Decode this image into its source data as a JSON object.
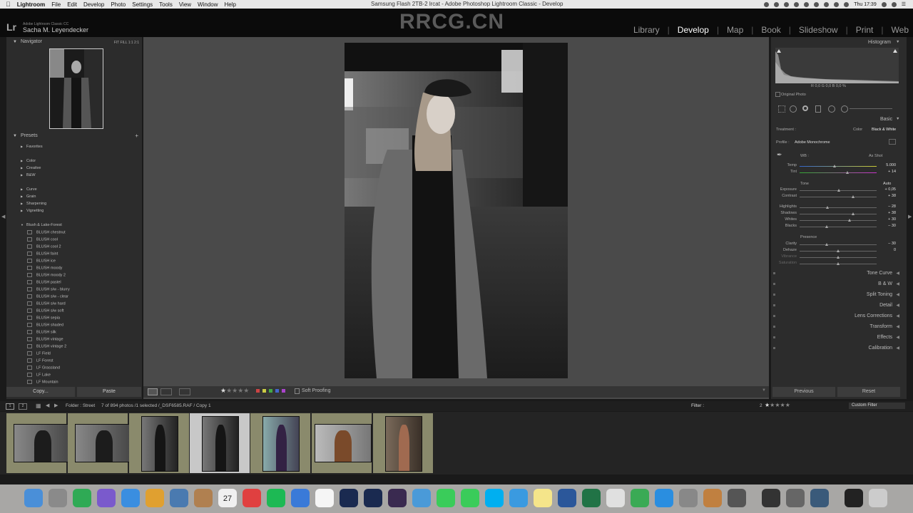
{
  "menubar": {
    "apple": "",
    "items": [
      "Lightroom",
      "File",
      "Edit",
      "Develop",
      "Photo",
      "Settings",
      "Tools",
      "View",
      "Window",
      "Help"
    ],
    "window_title": "Samsung Flash 2TB-2 lrcat - Adobe Photoshop Lightroom Classic - Develop",
    "clock": "Thu 17:39"
  },
  "header": {
    "logo": "Lr",
    "app_edition": "Adobe Lightroom Classic CC",
    "user": "Sacha M. Leyendecker",
    "watermark": "RRCG.CN",
    "modules": [
      "Library",
      "Develop",
      "Map",
      "Book",
      "Slideshow",
      "Print",
      "Web"
    ],
    "active_module": "Develop"
  },
  "navigator": {
    "title": "Navigator",
    "zoom": "FIT   FILL   1:1   2:1"
  },
  "presets": {
    "title": "Presets",
    "add": "+",
    "groups1": [
      "Favorites"
    ],
    "groups2": [
      "Color",
      "Creative",
      "B&W"
    ],
    "groups3": [
      "Curve",
      "Grain",
      "Sharpening",
      "Vignetting"
    ],
    "open_group": "Blush & Lake-Forest",
    "items": [
      "BLUSH chestnut",
      "BLUSH cool",
      "BLUSH cool 2",
      "BLUSH faint",
      "BLUSH ice",
      "BLUSH moody",
      "BLUSH moody 2",
      "BLUSH pastel",
      "BLUSH s/w - blurry",
      "BLUSH s/w - clear",
      "BLUSH s/w hard",
      "BLUSH s/w soft",
      "BLUSH sepia",
      "BLUSH shaded",
      "BLUSH silk",
      "BLUSH vintage",
      "BLUSH vintage 2",
      "LF Field",
      "LF Forest",
      "LF Grassland",
      "LF Lake",
      "LF Mountain"
    ]
  },
  "left_buttons": {
    "copy": "Copy...",
    "paste": "Paste"
  },
  "toolbar": {
    "soft_proofing": "Soft Proofing"
  },
  "histogram": {
    "title": "Histogram",
    "readout": "R   0,0  G   0,0  B   0,0  %",
    "original_photo": "Original Photo"
  },
  "basic": {
    "title": "Basic",
    "treatment_label": "Treatment :",
    "treatment_color": "Color",
    "treatment_bw": "Black & White",
    "profile_label": "Profile :",
    "profile_value": "Adobe Monochrome",
    "wb_label": "WB :",
    "wb_value": "As Shot",
    "temp": {
      "label": "Temp",
      "value": "5.000"
    },
    "tint": {
      "label": "Tint",
      "value": "+ 14"
    },
    "tone_label": "Tone",
    "auto": "Auto",
    "exposure": {
      "label": "Exposure",
      "value": "+ 0,05"
    },
    "contrast": {
      "label": "Contrast",
      "value": "+ 38"
    },
    "highlights": {
      "label": "Highlights",
      "value": "– 28"
    },
    "shadows": {
      "label": "Shadows",
      "value": "+ 38"
    },
    "whites": {
      "label": "Whites",
      "value": "+ 30"
    },
    "blacks": {
      "label": "Blacks",
      "value": "– 30"
    },
    "presence_label": "Presence",
    "clarity": {
      "label": "Clarity",
      "value": "– 30"
    },
    "dehaze": {
      "label": "Dehaze",
      "value": "0"
    },
    "vibrance": {
      "label": "Vibrance",
      "value": ""
    },
    "saturation": {
      "label": "Saturation",
      "value": ""
    }
  },
  "sections": [
    "Tone Curve",
    "B & W",
    "Split Toning",
    "Detail",
    "Lens Corrections",
    "Transform",
    "Effects",
    "Calibration"
  ],
  "right_buttons": {
    "previous": "Previous",
    "reset": "Reset"
  },
  "film_bar": {
    "view1": "1",
    "view2": "2",
    "folder": "Folder : Street",
    "count": "7 of 894 photos /1 selected /_DSF6585.RAF / Copy 1",
    "filter_label": "Filter :",
    "rating_count": "2",
    "custom_filter": "Custom Filter"
  },
  "colors": {
    "menubar": "#e8e8e8",
    "panel": "#2c2c2c",
    "canvas": "#4a4a4a",
    "film_cell": "#8a8a6c",
    "film_selected": "#c8c8c8",
    "dock": "#a8a7a5"
  },
  "dock_icons": [
    "finder-icon",
    "launchpad-icon",
    "evernote-icon",
    "siri-icon",
    "safari-icon",
    "chrome-icon",
    "preview-icon",
    "notes-box-icon",
    "calendar-icon",
    "google-icon",
    "spotify-icon",
    "keynote-icon",
    "reminders-icon",
    "photoshop-icon",
    "lightroom-icon",
    "rush-icon",
    "1password-icon",
    "messages-icon",
    "facetime-icon",
    "skype-icon",
    "tweetbot-icon",
    "stickies-icon",
    "word-icon",
    "excel-icon",
    "textedit-icon",
    "numbers-icon",
    "appstore-icon",
    "sysprefs-icon",
    "books-icon",
    "printer-icon",
    "capture-icon",
    "scribble-icon",
    "quicktime-icon",
    "display-icon",
    "trash-icon"
  ],
  "calendar_day": "27"
}
